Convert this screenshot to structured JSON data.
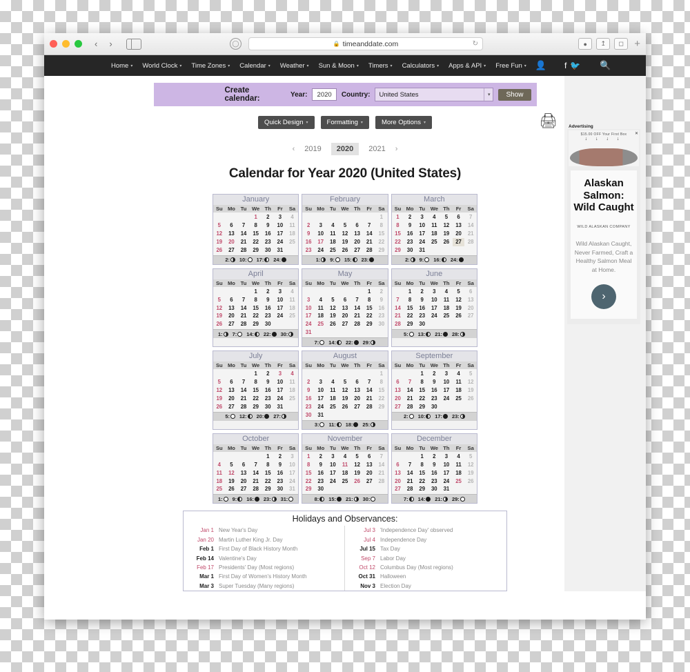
{
  "browser": {
    "url": "timeanddate.com",
    "lock_icon": "lock-icon",
    "reload_icon": "reload-icon",
    "back_label": "‹",
    "forward_label": "›",
    "sidebar_icon": "sidebar-icon",
    "shield_icon": "shield-icon",
    "download_icon": "download-icon",
    "share_icon": "share-icon",
    "tabs_icon": "tabs-icon",
    "newtab_label": "+"
  },
  "topnav": {
    "items": [
      {
        "label": "Home",
        "caret": "▼"
      },
      {
        "label": "World Clock",
        "caret": "▼"
      },
      {
        "label": "Time Zones",
        "caret": "▼"
      },
      {
        "label": "Calendar",
        "caret": "▼"
      },
      {
        "label": "Weather",
        "caret": "▼"
      },
      {
        "label": "Sun & Moon",
        "caret": "▼"
      },
      {
        "label": "Timers",
        "caret": "▼"
      },
      {
        "label": "Calculators",
        "caret": "▼"
      },
      {
        "label": "Apps & API",
        "caret": "▼"
      },
      {
        "label": "Free Fun",
        "caret": "▼"
      }
    ],
    "account_icon": "person-icon",
    "facebook_icon": "facebook-icon",
    "twitter_icon": "twitter-icon",
    "search_icon": "search-icon"
  },
  "create_calendar": {
    "title": "Create calendar:",
    "year_label": "Year:",
    "year_value": "2020",
    "country_label": "Country:",
    "country_value": "United States",
    "show_label": "Show",
    "chevron": "▼"
  },
  "options": {
    "buttons": [
      {
        "label": "Quick Design",
        "caret": "▼"
      },
      {
        "label": "Formatting",
        "caret": "▼"
      },
      {
        "label": "More Options",
        "caret": "▼"
      }
    ],
    "print_icon": "printer-icon"
  },
  "year_nav": {
    "prev_arrow": "‹",
    "next_arrow": "›",
    "prev_year": "2019",
    "current_year": "2020",
    "next_year": "2021"
  },
  "page_title": "Calendar for Year 2020 (United States)",
  "dow": [
    "Su",
    "Mo",
    "Tu",
    "We",
    "Th",
    "Fr",
    "Sa"
  ],
  "calendar": {
    "year": 2020,
    "country": "United States",
    "months": [
      {
        "name": "January",
        "lead_blanks": 3,
        "days": 31,
        "holidays": [
          1,
          20
        ],
        "outside": [
          4,
          11,
          18,
          25
        ],
        "selected": [],
        "moon": [
          {
            "day": "2",
            "phase": "first"
          },
          {
            "day": "10",
            "phase": "full"
          },
          {
            "day": "17",
            "phase": "last"
          },
          {
            "day": "24",
            "phase": "new"
          }
        ]
      },
      {
        "name": "February",
        "lead_blanks": 6,
        "days": 29,
        "holidays": [
          17
        ],
        "outside": [
          1,
          8,
          15,
          22,
          29
        ],
        "selected": [],
        "moon": [
          {
            "day": "1",
            "phase": "first"
          },
          {
            "day": "9",
            "phase": "full"
          },
          {
            "day": "15",
            "phase": "last"
          },
          {
            "day": "23",
            "phase": "new"
          }
        ]
      },
      {
        "name": "March",
        "lead_blanks": 0,
        "days": 31,
        "holidays": [],
        "outside": [
          7,
          14,
          21,
          28
        ],
        "selected": [
          27
        ],
        "moon": [
          {
            "day": "2",
            "phase": "first"
          },
          {
            "day": "9",
            "phase": "full"
          },
          {
            "day": "16",
            "phase": "last"
          },
          {
            "day": "24",
            "phase": "new"
          }
        ]
      },
      {
        "name": "April",
        "lead_blanks": 3,
        "days": 30,
        "holidays": [],
        "outside": [
          4,
          11,
          18,
          25
        ],
        "selected": [],
        "moon": [
          {
            "day": "1",
            "phase": "first"
          },
          {
            "day": "7",
            "phase": "full"
          },
          {
            "day": "14",
            "phase": "last"
          },
          {
            "day": "22",
            "phase": "new"
          },
          {
            "day": "30",
            "phase": "first"
          }
        ]
      },
      {
        "name": "May",
        "lead_blanks": 5,
        "days": 31,
        "holidays": [
          25
        ],
        "outside": [
          2,
          9,
          16,
          23,
          30
        ],
        "selected": [],
        "moon": [
          {
            "day": "7",
            "phase": "full"
          },
          {
            "day": "14",
            "phase": "last"
          },
          {
            "day": "22",
            "phase": "new"
          },
          {
            "day": "29",
            "phase": "first"
          }
        ]
      },
      {
        "name": "June",
        "lead_blanks": 1,
        "days": 30,
        "holidays": [],
        "outside": [
          6,
          13,
          20,
          27
        ],
        "selected": [],
        "moon": [
          {
            "day": "5",
            "phase": "full"
          },
          {
            "day": "13",
            "phase": "last"
          },
          {
            "day": "21",
            "phase": "new"
          },
          {
            "day": "28",
            "phase": "first"
          }
        ]
      },
      {
        "name": "July",
        "lead_blanks": 3,
        "days": 31,
        "holidays": [
          3,
          4
        ],
        "outside": [
          11,
          18,
          25
        ],
        "selected": [],
        "moon": [
          {
            "day": "5",
            "phase": "full"
          },
          {
            "day": "12",
            "phase": "last"
          },
          {
            "day": "20",
            "phase": "new"
          },
          {
            "day": "27",
            "phase": "first"
          }
        ]
      },
      {
        "name": "August",
        "lead_blanks": 6,
        "days": 31,
        "holidays": [],
        "outside": [
          1,
          8,
          15,
          22,
          29
        ],
        "selected": [],
        "moon": [
          {
            "day": "3",
            "phase": "full"
          },
          {
            "day": "11",
            "phase": "last"
          },
          {
            "day": "18",
            "phase": "new"
          },
          {
            "day": "25",
            "phase": "first"
          }
        ]
      },
      {
        "name": "September",
        "lead_blanks": 2,
        "days": 30,
        "holidays": [
          7
        ],
        "outside": [
          5,
          12,
          19,
          26
        ],
        "selected": [],
        "moon": [
          {
            "day": "2",
            "phase": "full"
          },
          {
            "day": "10",
            "phase": "last"
          },
          {
            "day": "17",
            "phase": "new"
          },
          {
            "day": "23",
            "phase": "first"
          }
        ]
      },
      {
        "name": "October",
        "lead_blanks": 4,
        "days": 31,
        "holidays": [
          12
        ],
        "outside": [
          3,
          10,
          17,
          24,
          31
        ],
        "selected": [],
        "moon": [
          {
            "day": "1",
            "phase": "full"
          },
          {
            "day": "9",
            "phase": "last"
          },
          {
            "day": "16",
            "phase": "new"
          },
          {
            "day": "23",
            "phase": "first"
          },
          {
            "day": "31",
            "phase": "full"
          }
        ]
      },
      {
        "name": "November",
        "lead_blanks": 0,
        "days": 30,
        "holidays": [
          11,
          26
        ],
        "outside": [
          7,
          14,
          21,
          28
        ],
        "selected": [],
        "moon": [
          {
            "day": "8",
            "phase": "last"
          },
          {
            "day": "15",
            "phase": "new"
          },
          {
            "day": "21",
            "phase": "first"
          },
          {
            "day": "30",
            "phase": "full"
          }
        ]
      },
      {
        "name": "December",
        "lead_blanks": 2,
        "days": 31,
        "holidays": [
          25
        ],
        "outside": [
          5,
          12,
          19,
          26
        ],
        "selected": [],
        "moon": [
          {
            "day": "7",
            "phase": "last"
          },
          {
            "day": "14",
            "phase": "new"
          },
          {
            "day": "21",
            "phase": "first"
          },
          {
            "day": "29",
            "phase": "full"
          }
        ]
      }
    ]
  },
  "holidays_section": {
    "title": "Holidays and Observances:",
    "left": [
      {
        "date": "Jan 1",
        "name": "New Year's Day",
        "red": true
      },
      {
        "date": "Jan 20",
        "name": "Martin Luther King Jr. Day",
        "red": true
      },
      {
        "date": "Feb 1",
        "name": "First Day of Black History Month",
        "red": false
      },
      {
        "date": "Feb 14",
        "name": "Valentine's Day",
        "red": false
      },
      {
        "date": "Feb 17",
        "name": "Presidents' Day (Most regions)",
        "red": true
      },
      {
        "date": "Mar 1",
        "name": "First Day of Women's History Month",
        "red": false
      },
      {
        "date": "Mar 3",
        "name": "Super Tuesday (Many regions)",
        "red": false
      }
    ],
    "right": [
      {
        "date": "Jul 3",
        "name": "'Independence Day' observed",
        "red": true
      },
      {
        "date": "Jul 4",
        "name": "Independence Day",
        "red": true
      },
      {
        "date": "Jul 15",
        "name": "Tax Day",
        "red": false
      },
      {
        "date": "Sep 7",
        "name": "Labor Day",
        "red": true
      },
      {
        "date": "Oct 12",
        "name": "Columbus Day (Most regions)",
        "red": true
      },
      {
        "date": "Oct 31",
        "name": "Halloween",
        "red": false
      },
      {
        "date": "Nov 3",
        "name": "Election Day",
        "red": false
      }
    ]
  },
  "ad": {
    "label": "Advertising",
    "promo": "$15.00  OFF  Your First Box",
    "arrows": "↓ ↓ ↓ ↓",
    "close": "✕",
    "headline": "Alaskan Salmon: Wild Caught",
    "brand": "WILD ALASKAN COMPANY",
    "copy": "Wild Alaskan Caught, Never Farmed, Craft a Healthy Salmon Meal at Home.",
    "cta_icon": "chevron-right-icon"
  },
  "colors": {
    "accent_purple": "#cdb6e4",
    "holiday_red": "#c0496a",
    "nav_dark": "#262626",
    "month_border": "#b9b9cf",
    "cta_blue": "#4e6570"
  }
}
